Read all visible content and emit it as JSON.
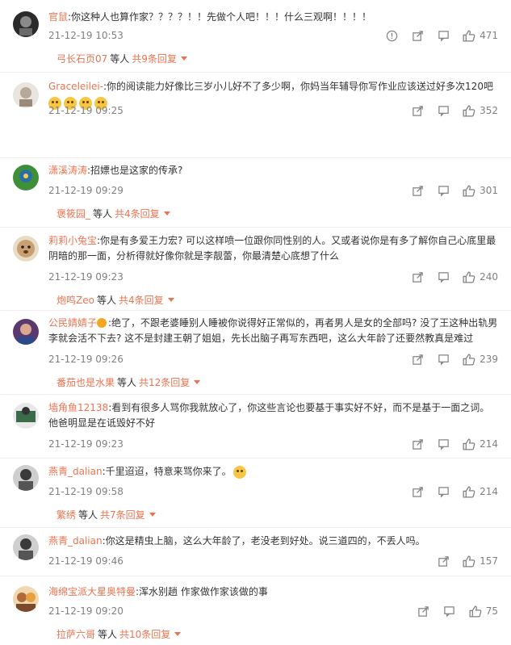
{
  "comments": [
    {
      "user": "官鼠",
      "text": ":你这种人也算作家？？？？！！先做个人吧！！！什么三观啊！！！！",
      "time": "21-12-19 10:53",
      "likes": "471",
      "report": true,
      "replies": {
        "user": "弓长石页07",
        "mid": "等人",
        "count": "共9条回复"
      },
      "avatar_color": "#2b2b2b"
    },
    {
      "user": "Graceleilei-",
      "text": ":你的阅读能力好像比三岁小儿好不了多少啊，你妈当年辅导你写作业应该送过好多次120吧",
      "emoji_count": 4,
      "time": "21-12-19 09:25",
      "likes": "352",
      "report": false,
      "replies": {
        "user": "用户e1zl9hd5n3",
        "mid": "等人",
        "count": "共2条回复"
      },
      "avatar_color": "#c9c4c0"
    },
    {
      "user": "潇溪涛涛",
      "text": ":招嫖也是这家的传承?",
      "time": "21-12-19 09:29",
      "likes": "301",
      "report": false,
      "replies": {
        "user": "褒筱园_",
        "mid": "等人",
        "count": "共4条回复"
      },
      "avatar_color": "#3f8f3a"
    },
    {
      "user": "莉莉小兔宝",
      "text": ":你是有多爱王力宏? 可以这样喷一位跟你同性别的人。又或者说你是有多了解你自己心底里最阴暗的那一面，分析得就好像你就是李靓蕾，你最清楚心底想了什么",
      "time": "21-12-19 09:23",
      "likes": "240",
      "report": false,
      "replies": {
        "user": "炮鸣Zeo",
        "mid": "等人",
        "count": "共4条回复"
      },
      "avatar_color": "#c9a070"
    },
    {
      "user": "公民婧婧子",
      "badge": true,
      "text": ":绝了，不跟老婆睡别人睡被你说得好正常似的，再者男人是女的全部吗? 没了王这种出轨男李就会活不下去? 这不是封建王朝了姐姐，先长出脑子再写东西吧，这么大年龄了还要然教真是难过",
      "time": "21-12-19 09:26",
      "likes": "239",
      "report": false,
      "replies": {
        "user": "番茄也是水果",
        "mid": "等人",
        "count": "共12条回复"
      },
      "avatar_color": "#5a3a6e"
    },
    {
      "user": "墙角鱼12138",
      "text": ":看到有很多人骂你我就放心了，你这些言论也要基于事实好不好，而不是基于一面之词。他爸明显是在诋毁好不好",
      "time": "21-12-19 09:23",
      "likes": "214",
      "report": false,
      "avatar_color": "#3a6b4a"
    },
    {
      "user": "燕青_dalian",
      "text": ":千里迢迢，特意来骂你来了。",
      "emoji_count": 1,
      "time": "21-12-19 09:58",
      "likes": "214",
      "report": false,
      "replies": {
        "user": "繁绣",
        "mid": "等人",
        "count": "共7条回复"
      },
      "avatar_color": "#3a3a3a"
    },
    {
      "user": "燕青_dalian",
      "text": ":你这是精虫上脑，这么大年龄了，老没老到好处。说三道四的，不丢人吗。",
      "time": "21-12-19 09:46",
      "likes": "157",
      "report": false,
      "avatar_color": "#3a3a3a"
    },
    {
      "user": "海绵宝派大星奥特曼",
      "text": ":浑水别趟 作家做作家该做的事",
      "time": "21-12-19 09:20",
      "likes": "75",
      "report": false,
      "replies": {
        "user": "拉萨六哥",
        "mid": "等人",
        "count": "共10条回复"
      },
      "avatar_color": "#b06a3a"
    }
  ]
}
